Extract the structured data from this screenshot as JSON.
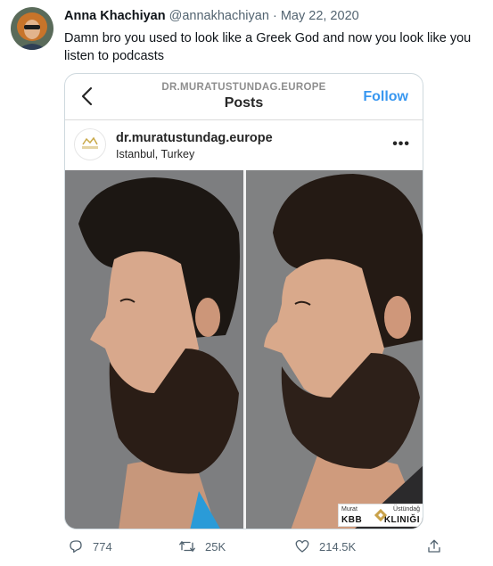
{
  "tweet": {
    "author_name": "Anna Khachiyan",
    "handle": "@annakhachiyan",
    "separator": "·",
    "date": "May 22, 2020",
    "text": "Damn bro you used to look like a Greek God and now you look like you listen to podcasts"
  },
  "instagram": {
    "site": "DR.MURATUSTUNDAG.EUROPE",
    "title": "Posts",
    "follow_label": "Follow",
    "username": "dr.muratustundag.europe",
    "location": "Istanbul, Turkey",
    "more_label": "•••",
    "avatar_text": "MURAT ÜSTÜNDAĞ KBB KLINIK",
    "watermark": {
      "line1_left": "Murat",
      "line1_right": "Üstündağ",
      "line2_left": "KBB",
      "line2_right": "KLINIĞI"
    }
  },
  "actions": {
    "replies": "774",
    "retweets": "25K",
    "likes": "214.5K"
  },
  "colors": {
    "link_blue": "#3897f0",
    "muted": "#536471",
    "border": "#cfd9de"
  }
}
